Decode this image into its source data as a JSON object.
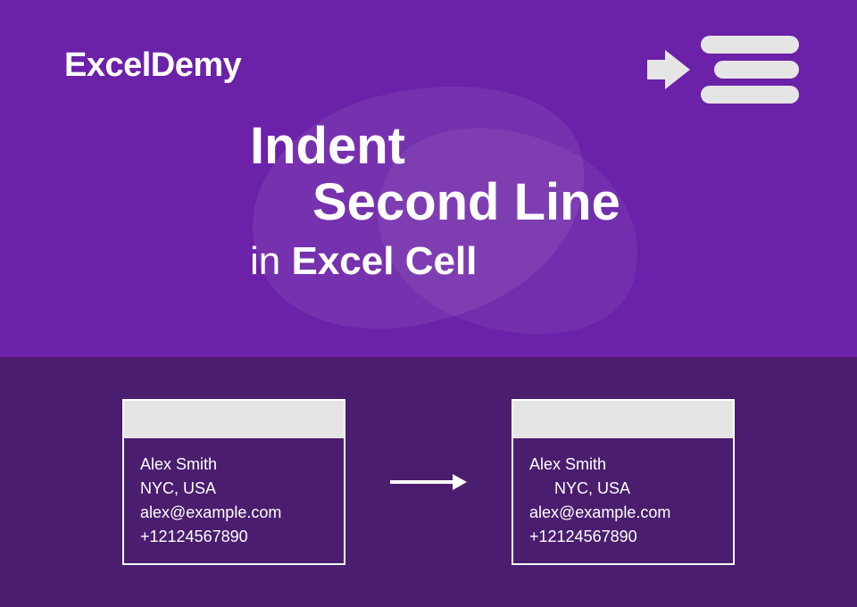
{
  "brand": {
    "logo": "ExcelDemy"
  },
  "title": {
    "line1": "Indent",
    "line2": "Second Line",
    "line3_prefix": "in ",
    "line3_bold": "Excel Cell"
  },
  "example": {
    "before": {
      "name": "Alex Smith",
      "location": "NYC, USA",
      "email": "alex@example.com",
      "phone": "+12124567890"
    },
    "after": {
      "name": "Alex Smith",
      "location": "NYC, USA",
      "email": "alex@example.com",
      "phone": "+12124567890"
    }
  }
}
